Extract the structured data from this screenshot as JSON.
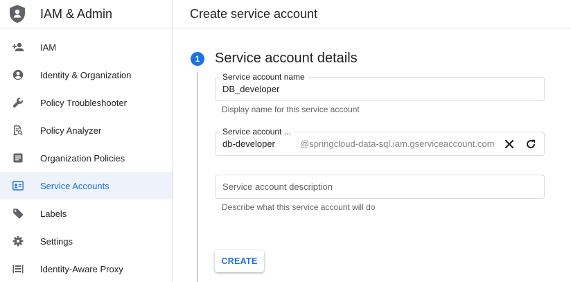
{
  "product": {
    "title": "IAM & Admin",
    "icon": "shield-person-icon"
  },
  "page": {
    "title": "Create service account"
  },
  "nav": {
    "items": [
      {
        "label": "IAM",
        "icon": "person-add-icon"
      },
      {
        "label": "Identity & Organization",
        "icon": "account-circle-icon"
      },
      {
        "label": "Policy Troubleshooter",
        "icon": "wrench-icon"
      },
      {
        "label": "Policy Analyzer",
        "icon": "document-search-icon"
      },
      {
        "label": "Organization Policies",
        "icon": "list-document-icon"
      },
      {
        "label": "Service Accounts",
        "icon": "service-account-icon",
        "active": true
      },
      {
        "label": "Labels",
        "icon": "label-tag-icon"
      },
      {
        "label": "Settings",
        "icon": "gear-icon"
      },
      {
        "label": "Identity-Aware Proxy",
        "icon": "proxy-icon"
      }
    ]
  },
  "step": {
    "number": "1",
    "title": "Service account details"
  },
  "form": {
    "name": {
      "label": "Service account name",
      "value": "DB_developer",
      "hint": "Display name for this service account"
    },
    "id": {
      "label": "Service account ...",
      "value": "db-developer",
      "suffix": "@springcloud-data-sql.iam.gserviceaccount.com",
      "clear_icon": "close-icon",
      "refresh_icon": "refresh-icon"
    },
    "description": {
      "placeholder": "Service account description",
      "hint": "Describe what this service account will do"
    },
    "create_label": "CREATE"
  },
  "colors": {
    "accent": "#1a73e8",
    "active_bg": "#eef3fb",
    "icon": "#5f6368",
    "border": "#dadce0"
  }
}
